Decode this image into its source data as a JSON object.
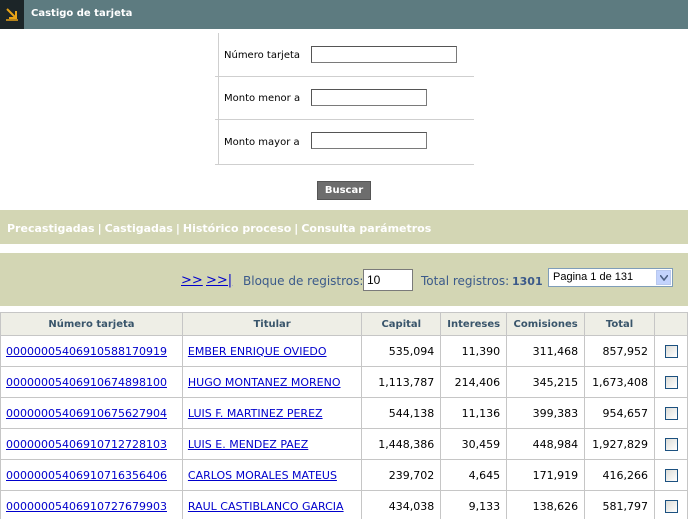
{
  "header": {
    "title": "Castigo de tarjeta",
    "icon": "arrow-down-right-icon"
  },
  "form": {
    "fields": [
      {
        "label": "Número tarjeta",
        "value": ""
      },
      {
        "label": "Monto menor a",
        "value": ""
      },
      {
        "label": "Monto mayor a",
        "value": ""
      }
    ],
    "search_label": "Buscar"
  },
  "nav": {
    "items": [
      "Precastigadas",
      "Castigadas",
      "Histórico proceso",
      "Consulta parámetros"
    ],
    "separator": "|"
  },
  "pager": {
    "next_label": ">>",
    "last_label": ">>|",
    "block_label": "Bloque de registros:",
    "block_value": "10",
    "total_label": "Total registros:",
    "total_value": "1301",
    "page_select": "Pagina 1 de 131"
  },
  "table": {
    "columns": [
      "Número tarjeta",
      "Titular",
      "Capital",
      "Intereses",
      "Comisiones",
      "Total",
      ""
    ],
    "rows": [
      {
        "card": "0000000540691058817091​9",
        "holder": "EMBER ENRIQUE OVIEDO",
        "capital": "535,094",
        "intereses": "11,390",
        "comisiones": "311,468",
        "total": "857,952"
      },
      {
        "card": "0000000540691067489810​0",
        "holder": "HUGO MONTANEZ MORENO",
        "capital": "1,113,787",
        "intereses": "214,406",
        "comisiones": "345,215",
        "total": "1,673,408"
      },
      {
        "card": "0000000540691067562790​4",
        "holder": "LUIS F. MARTINEZ PEREZ",
        "capital": "544,138",
        "intereses": "11,136",
        "comisiones": "399,383",
        "total": "954,657"
      },
      {
        "card": "0000000540691071272810​3",
        "holder": "LUIS E. MENDEZ PAEZ",
        "capital": "1,448,386",
        "intereses": "30,459",
        "comisiones": "448,984",
        "total": "1,927,829"
      },
      {
        "card": "0000000540691071635640​6",
        "holder": "CARLOS MORALES MATEUS",
        "capital": "239,702",
        "intereses": "4,645",
        "comisiones": "171,919",
        "total": "416,266"
      },
      {
        "card": "0000000540691072767990​3",
        "holder": "RAUL CASTIBLANCO GARCIA",
        "capital": "434,038",
        "intereses": "9,133",
        "comisiones": "138,626",
        "total": "581,797"
      }
    ]
  }
}
